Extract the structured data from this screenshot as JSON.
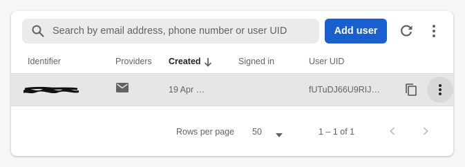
{
  "search": {
    "placeholder": "Search by email address, phone number or user UID",
    "icon": "search-icon"
  },
  "toolbar": {
    "add_user_label": "Add user",
    "refresh_icon": "refresh-icon",
    "more_icon": "more-vert-icon"
  },
  "table": {
    "columns": [
      "Identifier",
      "Providers",
      "Created",
      "Signed in",
      "User UID"
    ],
    "sorted_column": "Created",
    "sort_direction": "descending",
    "rows": [
      {
        "identifier": "",
        "provider_icon": "email-icon",
        "created": "19 Apr …",
        "signed_in": "",
        "uid": "fUTuDJ66U9RIJ…"
      }
    ]
  },
  "pagination": {
    "rows_per_page_label": "Rows per page",
    "rows_per_page": "50",
    "range": "1 – 1 of 1"
  },
  "colors": {
    "accent": "#1a5fd0",
    "selected_row": "#e6e6e6",
    "search_bg": "#ebebeb"
  }
}
